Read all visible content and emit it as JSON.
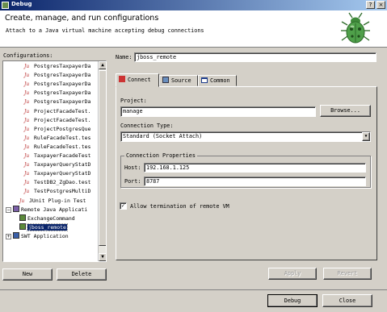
{
  "window": {
    "title": "Debug",
    "btn_help": "?",
    "btn_close": "×"
  },
  "header": {
    "title": "Create, manage, and run configurations",
    "subtitle": "Attach to a Java virtual machine accepting debug connections"
  },
  "configurations": {
    "label": "Configurations:",
    "tree": [
      {
        "text": "PostgresTaxpayerDa",
        "level": 3,
        "icon": "junit-icon"
      },
      {
        "text": "PostgresTaxpayerDa",
        "level": 3,
        "icon": "junit-icon"
      },
      {
        "text": "PostgresTaxpayerDa",
        "level": 3,
        "icon": "junit-icon"
      },
      {
        "text": "PostgresTaxpayerDa",
        "level": 3,
        "icon": "junit-icon"
      },
      {
        "text": "PostgresTaxpayerDa",
        "level": 3,
        "icon": "junit-icon"
      },
      {
        "text": "ProjectFacadeTest.",
        "level": 3,
        "icon": "junit-icon"
      },
      {
        "text": "ProjectFacadeTest.",
        "level": 3,
        "icon": "junit-icon"
      },
      {
        "text": "ProjectPostgresQue",
        "level": 3,
        "icon": "junit-icon"
      },
      {
        "text": "RuleFacadeTest.tes",
        "level": 3,
        "icon": "junit-icon"
      },
      {
        "text": "RuleFacadeTest.tes",
        "level": 3,
        "icon": "junit-icon"
      },
      {
        "text": "TaxpayerFacadeTest",
        "level": 3,
        "icon": "junit-icon"
      },
      {
        "text": "TaxpayerQueryStatD",
        "level": 3,
        "icon": "junit-icon"
      },
      {
        "text": "TaxpayerQueryStatD",
        "level": 3,
        "icon": "junit-icon"
      },
      {
        "text": "TestDB2_ZgDao.test",
        "level": 3,
        "icon": "junit-icon"
      },
      {
        "text": "TestPostgresMultiD",
        "level": 3,
        "icon": "junit-icon"
      },
      {
        "text": "JUnit Plug-in Test",
        "level": 2,
        "icon": "junit-plugin-icon"
      },
      {
        "text": "Remote Java Applicati",
        "level": 1,
        "icon": "remote-java-icon",
        "expanded": true
      },
      {
        "text": "ExchangeCommand",
        "level": 2,
        "icon": "debug-config-icon"
      },
      {
        "text": "jboss_remote",
        "level": 2,
        "icon": "debug-config-icon",
        "selected": true
      },
      {
        "text": "SWT Application",
        "level": 1,
        "icon": "swt-icon"
      }
    ],
    "new_button": "New",
    "delete_button": "Delete"
  },
  "name": {
    "label": "Name:",
    "value": "jboss_remote"
  },
  "tabs": [
    {
      "label": "Connect",
      "icon": "connect-icon",
      "selected": true
    },
    {
      "label": "Source",
      "icon": "source-icon"
    },
    {
      "label": "Common",
      "icon": "common-icon"
    }
  ],
  "connect": {
    "project_label": "Project:",
    "project_value": "manage",
    "browse_button": "Browse...",
    "conn_type_label": "Connection Type:",
    "conn_type_value": "Standard (Socket Attach)",
    "props_label": "Connection Properties",
    "host_label": "Host:",
    "host_value": "192.168.1.125",
    "port_label": "Port:",
    "port_value": "8787",
    "allow_term_label": "Allow termination of remote VM",
    "allow_term_checked": true,
    "check_mark": "✓",
    "dropdown_arrow": "▼"
  },
  "actions": {
    "apply": "Apply",
    "revert": "Revert"
  },
  "footer": {
    "debug": "Debug",
    "close": "Close"
  },
  "colors": {
    "titlebar_start": "#0a246a",
    "titlebar_end": "#a6caf0",
    "selection": "#0a246a",
    "dialog": "#d4d0c8"
  }
}
